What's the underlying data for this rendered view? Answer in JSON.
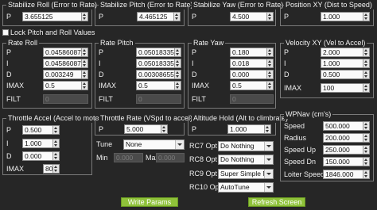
{
  "stab_roll": {
    "title": "Stabilize Roll (Error to Rate)",
    "p_label": "P",
    "p": "3.655125"
  },
  "stab_pitch": {
    "title": "Stabilize Pitch (Error to Rate)",
    "p_label": "P",
    "p": "4.465125"
  },
  "stab_yaw": {
    "title": "Stabilize Yaw (Error to Rate)",
    "p_label": "P",
    "p": "4.500"
  },
  "pos_xy": {
    "title": "Position XY (Dist to Speed)",
    "p_label": "P",
    "p": "1.000"
  },
  "lock_pitch_roll": {
    "label": "Lock Pitch and Roll Values",
    "checked": false
  },
  "rate_roll": {
    "title": "Rate Roll",
    "rows": [
      {
        "label": "P",
        "value": "0.04586087"
      },
      {
        "label": "I",
        "value": "0.04586087"
      },
      {
        "label": "D",
        "value": "0.003249"
      },
      {
        "label": "IMAX",
        "value": "0.5"
      },
      {
        "label": "FILT",
        "value": "0"
      }
    ]
  },
  "rate_pitch": {
    "title": "Rate Pitch",
    "rows": [
      {
        "label": "P",
        "value": "0.05018335"
      },
      {
        "label": "I",
        "value": "0.05018335"
      },
      {
        "label": "D",
        "value": "0.00308655"
      },
      {
        "label": "IMAX",
        "value": "0.5"
      },
      {
        "label": "FILT",
        "value": "0"
      }
    ]
  },
  "rate_yaw": {
    "title": "Rate Yaw",
    "rows": [
      {
        "label": "P",
        "value": "0.180"
      },
      {
        "label": "I",
        "value": "0.018"
      },
      {
        "label": "D",
        "value": "0.000"
      },
      {
        "label": "IMAX",
        "value": "0.5"
      },
      {
        "label": "FILT",
        "value": "0"
      }
    ]
  },
  "vel_xy": {
    "title": "Velocity XY (Vel to Accel)",
    "rows": [
      {
        "label": "P",
        "value": "2.000"
      },
      {
        "label": "I",
        "value": "1.000"
      },
      {
        "label": "D",
        "value": "0.500"
      },
      {
        "label": "IMAX",
        "value": "100"
      }
    ]
  },
  "throttle_accel": {
    "title": "Throttle Accel (Accel to motor)",
    "rows": [
      {
        "label": "P",
        "value": "0.500"
      },
      {
        "label": "I",
        "value": "1.000"
      },
      {
        "label": "D",
        "value": "0.000"
      },
      {
        "label": "IMAX",
        "value": "80"
      }
    ]
  },
  "throttle_rate": {
    "title": "Throttle Rate (VSpd to accel)",
    "p_label": "P",
    "p": "5.000"
  },
  "alt_hold": {
    "title": "Altitude Hold (Alt to climbrate)",
    "p_label": "P",
    "p": "1.000"
  },
  "tune": {
    "label": "Tune",
    "value": "None",
    "min_label": "Min",
    "min_value": "0.000",
    "max_label": "Max",
    "max_value": "0.000"
  },
  "rc_opts": [
    {
      "label": "RC7 Opt",
      "value": "Do Nothing"
    },
    {
      "label": "RC8 Opt",
      "value": "Do Nothing"
    },
    {
      "label": "RC9 Opt",
      "value": "Super Simple Mode"
    },
    {
      "label": "RC10 Opt",
      "value": "AutoTune"
    }
  ],
  "wpnav": {
    "title": "WPNav (cm's)",
    "rows": [
      {
        "label": "Speed",
        "value": "500.000"
      },
      {
        "label": "Radius",
        "value": "200.000"
      },
      {
        "label": "Speed Up",
        "value": "250.000"
      },
      {
        "label": "Speed Dn",
        "value": "150.000"
      },
      {
        "label": "Loiter Speed",
        "value": "1846.000"
      }
    ]
  },
  "buttons": {
    "write": "Write Params",
    "refresh": "Refresh Screen"
  },
  "colors": {
    "background": "#262626",
    "button": "#8fc23a",
    "border": "#7a7a7a"
  }
}
